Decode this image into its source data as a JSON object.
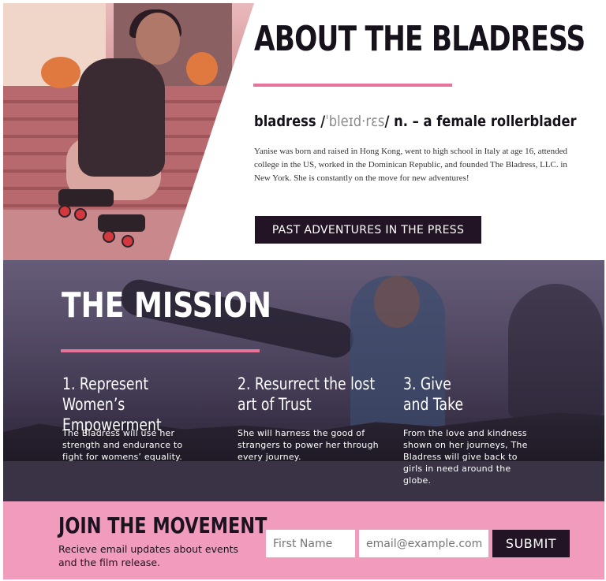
{
  "about": {
    "title": "ABOUT THE BLADRESS",
    "definition": {
      "word": "bladress /",
      "phonetic": "ˈbleɪd·rɛs",
      "rest": "/ n. – a female rollerblader"
    },
    "text": "Yanise was born and raised in Hong Kong, went to high school in Italy at age 16, attended college in the US, worked in the Dominican Republic, and founded The Bladress, LLC. in New York. She is constantly on the move for new adventures!",
    "button_label": "PAST ADVENTURES IN THE PRESS"
  },
  "mission": {
    "title": "THE MISSION",
    "goals": [
      {
        "title": "1. Represent Women’s\nEmpowerment",
        "text": "The Bladress will use her\nstrength and endurance to\nfight for womens’ equality."
      },
      {
        "title": "2. Resurrect the lost\nart of Trust",
        "text": "She will harness the good of\nstrangers to power her through\nevery journey."
      },
      {
        "title": "3. Give\nand Take",
        "text": "From the love and kindness\nshown on her journeys, The\nBladress will give back to\ngirls in need around the\nglobe."
      }
    ]
  },
  "join": {
    "title": "JOIN THE MOVEMENT",
    "text": "Recieve email updates about events and the film release.",
    "first_name_placeholder": "First Name",
    "email_placeholder": "email@example.com",
    "submit_label": "SUBMIT"
  },
  "colors": {
    "accent_pink": "#e7739a",
    "footer_pink": "#f29cbd",
    "button_dark": "#231425"
  }
}
